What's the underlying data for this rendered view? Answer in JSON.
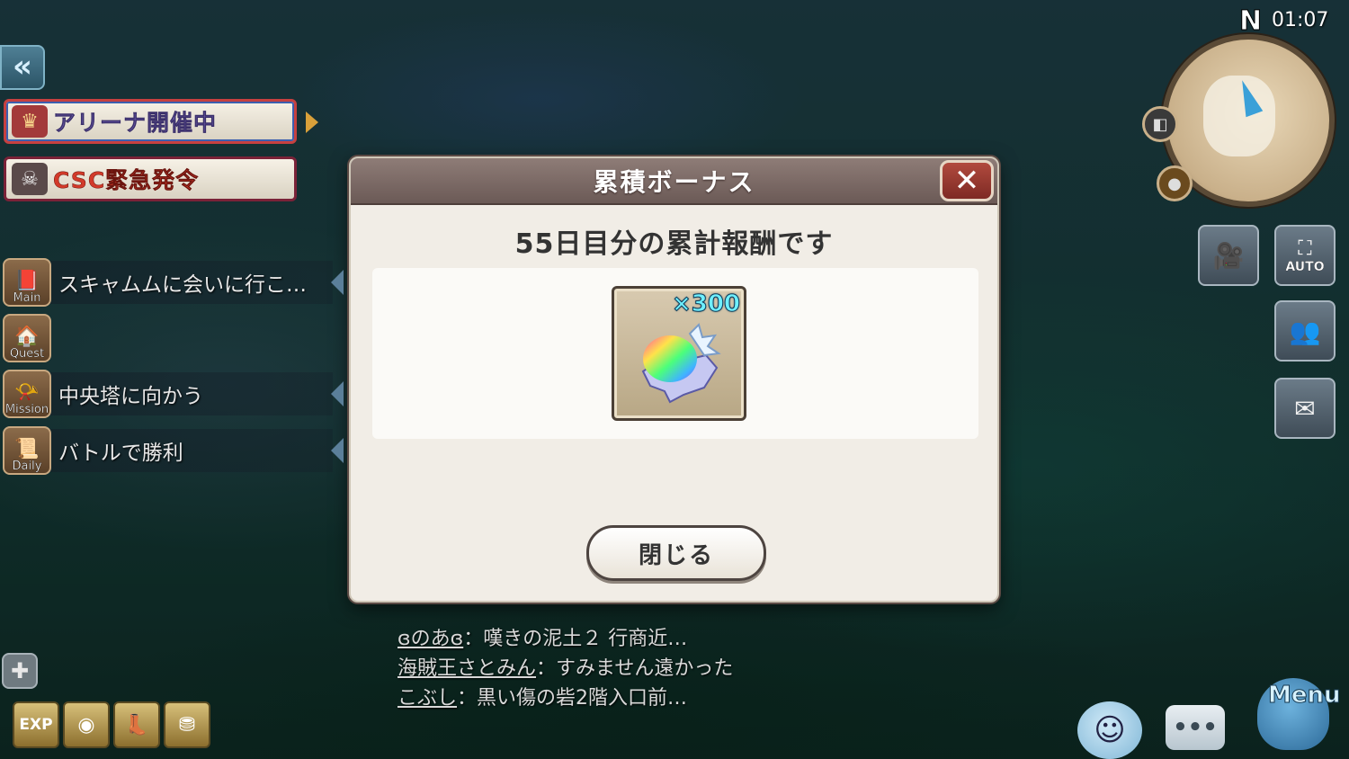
{
  "hud": {
    "compass": "N",
    "clock": "01:07",
    "auto_label": "AUTO",
    "menu_label": "Menu"
  },
  "banners": {
    "arena": "アリーナ開催中",
    "csc": "CSC緊急発令"
  },
  "quests": [
    {
      "tag": "Main",
      "label": "スキャムムに会いに行こ…"
    },
    {
      "tag": "Quest",
      "label": ""
    },
    {
      "tag": "Mission",
      "label": "中央塔に向かう"
    },
    {
      "tag": "Daily",
      "label": "バトルで勝利"
    }
  ],
  "boosts": [
    "EXP",
    "",
    "",
    ""
  ],
  "dialog": {
    "title": "累積ボーナス",
    "subtitle": "55日目分の累計報酬です",
    "reward": {
      "icon": "rainbow-gem-icon",
      "quantity": "×300"
    },
    "close_label": "閉じる"
  },
  "chat": [
    {
      "name": "ɞのあɞ",
      "message": "：嘆きの泥土２ 行商近…"
    },
    {
      "name": "海賊王さとみん",
      "message": "：すみません遠かった"
    },
    {
      "name": "こぶし",
      "message": "：黒い傷の砦2階入口前…"
    }
  ],
  "colors": {
    "dialog_header": "#7d6b66",
    "close_button": "#a0403a",
    "arena_border": "#c64040",
    "csc_text": "#d23a2a",
    "reward_qty": "#6ff0ff"
  }
}
